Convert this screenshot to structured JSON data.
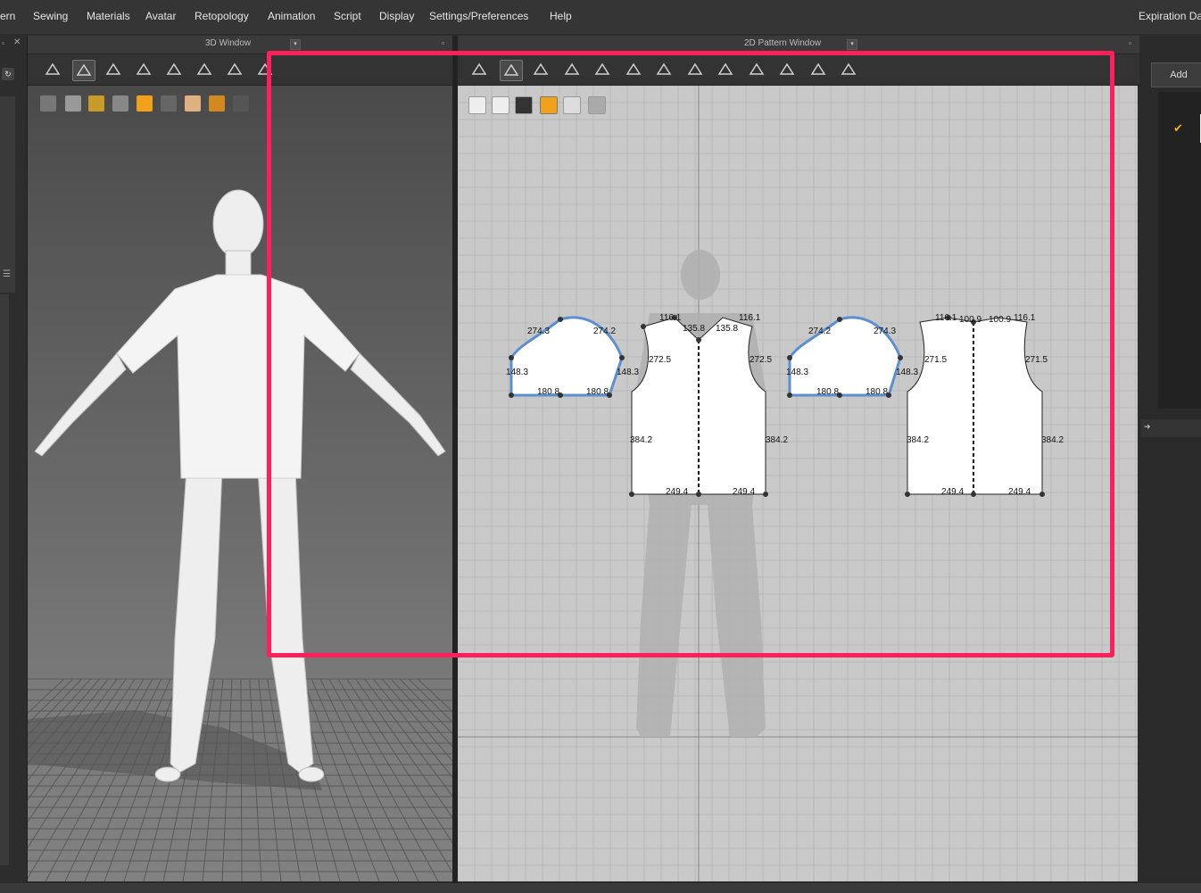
{
  "menu": {
    "items": [
      "ern",
      "Sewing",
      "Materials",
      "Avatar",
      "Retopology",
      "Animation",
      "Script",
      "Display",
      "Settings/Preferences",
      "Help"
    ],
    "expiration": "Expiration Da"
  },
  "window3d": {
    "title": "3D Window"
  },
  "window2d": {
    "title": "2D Pattern Window"
  },
  "right_panel": {
    "add_label": "Add"
  },
  "highlight_color": "#ff1f5a",
  "toolbar3d_icons": [
    "select-move-icon",
    "transform-icon",
    "edit-point-icon",
    "fold-icon",
    "pin-icon",
    "arrange-icon",
    "capture-icon",
    "more-icon"
  ],
  "toolbar2d_icons": [
    "segment-icon",
    "transform-pattern-icon",
    "polygon-icon",
    "rectangle-icon",
    "internal-shape-icon",
    "seam-icon",
    "segment-sewing-icon",
    "free-sewing-icon",
    "fold-arrangement-icon",
    "tuck-icon",
    "pleat-icon",
    "measure-icon",
    "shirt-icon"
  ],
  "measurements": {
    "sleeve_left": {
      "top_left": "274.3",
      "top_right": "274.2",
      "side_left": "148.3",
      "side_right": "148.3",
      "bottom_left": "180.8",
      "bottom_right": "180.8"
    },
    "front": {
      "shoulder_left": "116.1",
      "shoulder_right": "116.1",
      "neck_left": "135.8",
      "neck_right": "135.8",
      "arm_left": "272.5",
      "arm_right": "272.5",
      "side_left": "384.2",
      "side_right": "384.2",
      "hem_left": "249.4",
      "hem_right": "249.4"
    },
    "sleeve_right": {
      "top_left": "274.2",
      "top_right": "274.3",
      "side_left": "148.3",
      "side_right": "148.3",
      "bottom_left": "180.8",
      "bottom_right": "180.8"
    },
    "back": {
      "shoulder_left": "116.1",
      "shoulder_right": "116.1",
      "neck_left": "100.9",
      "neck_right": "100.9",
      "arm_left": "271.5",
      "arm_right": "271.5",
      "side_left": "384.2",
      "side_right": "384.2",
      "hem_left": "249.4",
      "hem_right": "249.4"
    }
  }
}
